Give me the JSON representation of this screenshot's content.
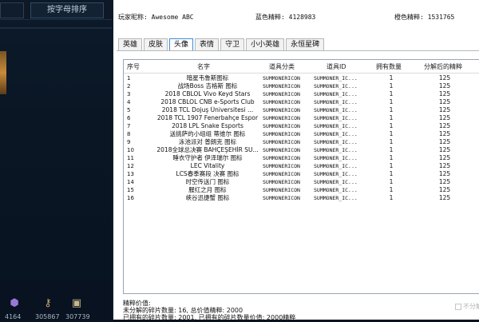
{
  "left_panel": {
    "sort_label": "按字母排序",
    "bottom_values": [
      "4164",
      "305867",
      "307739"
    ]
  },
  "header": {
    "player_label": "玩家昵称: Awesome ABC",
    "blue_essence": "蓝色精粹: 4128983",
    "orange_essence": "橙色精粹: 1531765"
  },
  "tabs": [
    {
      "label": "英雄",
      "active": false
    },
    {
      "label": "皮肤",
      "active": false
    },
    {
      "label": "头像",
      "active": true
    },
    {
      "label": "表情",
      "active": false
    },
    {
      "label": "守卫",
      "active": false
    },
    {
      "label": "小小英雄",
      "active": false
    },
    {
      "label": "永恒星碑",
      "active": false
    }
  ],
  "table": {
    "columns": [
      "序号",
      "名字",
      "道具分类",
      "道具ID",
      "拥有数量",
      "分解后的精粹"
    ],
    "rows": [
      [
        "1",
        "暗星韦鲁斯图标",
        "SUMMONERICON",
        "SUMMONER_IC...",
        "1",
        "125"
      ],
      [
        "2",
        "战场Boss 吉格斯 图标",
        "SUMMONERICON",
        "SUMMONER_IC...",
        "1",
        "125"
      ],
      [
        "3",
        "2018 CBLOL Vivo Keyd Stars",
        "SUMMONERICON",
        "SUMMONER_IC...",
        "1",
        "125"
      ],
      [
        "4",
        "2018 CBLOL CNB e-Sports Club",
        "SUMMONERICON",
        "SUMMONER_IC...",
        "1",
        "125"
      ],
      [
        "5",
        "2018 TCL Dojuş Üniversitesi ...",
        "SUMMONERICON",
        "SUMMONER_IC...",
        "1",
        "125"
      ],
      [
        "6",
        "2018 TCL 1907 Fenerbahçe Espor",
        "SUMMONERICON",
        "SUMMONER_IC...",
        "1",
        "125"
      ],
      [
        "7",
        "2018 LPL Snake Esports",
        "SUMMONERICON",
        "SUMMONER_IC...",
        "1",
        "125"
      ],
      [
        "8",
        "送挑萨的小组组 蒂维尔 图标",
        "SUMMONERICON",
        "SUMMONER_IC...",
        "1",
        "125"
      ],
      [
        "9",
        "泳池派对 普朗克 图标",
        "SUMMONERICON",
        "SUMMONER_IC...",
        "1",
        "125"
      ],
      [
        "10",
        "2018全球总决赛 BAHÇEŞEHİR SU...",
        "SUMMONERICON",
        "SUMMONER_IC...",
        "1",
        "125"
      ],
      [
        "11",
        "睡衣守护者 伊泽瑞尔 图标",
        "SUMMONERICON",
        "SUMMONER_IC...",
        "1",
        "125"
      ],
      [
        "12",
        "LEC Vitality",
        "SUMMONERICON",
        "SUMMONER_IC...",
        "1",
        "125"
      ],
      [
        "13",
        "LCS春季赛段 决赛 图标",
        "SUMMONERICON",
        "SUMMONER_IC...",
        "1",
        "125"
      ],
      [
        "14",
        "时空传送门 图标",
        "SUMMONERICON",
        "SUMMONER_IC...",
        "1",
        "125"
      ],
      [
        "15",
        "腥红之月 图标",
        "SUMMONERICON",
        "SUMMONER_IC...",
        "1",
        "125"
      ],
      [
        "16",
        "峡谷迅捷蟹 图标",
        "SUMMONERICON",
        "SUMMONER_IC...",
        "1",
        "125"
      ]
    ]
  },
  "footer": {
    "line1": "精粹价值:",
    "line2": "未分解的碎片数量: 16, 总价值精粹: 2000",
    "line3": "已拥有的碎片数量: 2001, 已拥有的碎片数量价值: 2000精粹"
  },
  "watermark": "不分解"
}
